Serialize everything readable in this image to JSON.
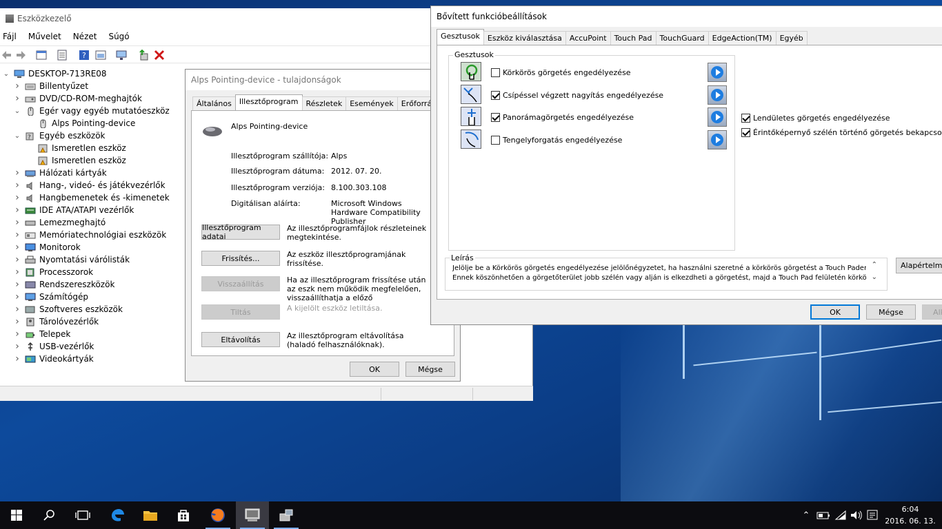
{
  "device_manager": {
    "title": "Eszközkezelő",
    "menu": [
      "Fájl",
      "Művelet",
      "Nézet",
      "Súgó"
    ],
    "root": "DESKTOP-713RE08",
    "tree": [
      {
        "label": "Billentyűzet",
        "depth": 1,
        "expanded": false,
        "icon": "keyboard-icon"
      },
      {
        "label": "DVD/CD-ROM-meghajtók",
        "depth": 1,
        "expanded": false,
        "icon": "disc-drive-icon"
      },
      {
        "label": "Egér vagy egyéb mutatóeszköz",
        "depth": 1,
        "expanded": true,
        "icon": "mouse-icon"
      },
      {
        "label": "Alps Pointing-device",
        "depth": 2,
        "expanded": null,
        "icon": "mouse-icon"
      },
      {
        "label": "Egyéb eszközök",
        "depth": 1,
        "expanded": true,
        "icon": "unknown-device-icon"
      },
      {
        "label": "Ismeretlen eszköz",
        "depth": 2,
        "expanded": null,
        "icon": "warning-device-icon"
      },
      {
        "label": "Ismeretlen eszköz",
        "depth": 2,
        "expanded": null,
        "icon": "warning-device-icon"
      },
      {
        "label": "Hálózati kártyák",
        "depth": 1,
        "expanded": false,
        "icon": "network-icon"
      },
      {
        "label": "Hang-, videó- és játékvezérlők",
        "depth": 1,
        "expanded": false,
        "icon": "speaker-icon"
      },
      {
        "label": "Hangbemenetek és -kimenetek",
        "depth": 1,
        "expanded": false,
        "icon": "speaker-icon"
      },
      {
        "label": "IDE ATA/ATAPI vezérlők",
        "depth": 1,
        "expanded": false,
        "icon": "ide-controller-icon"
      },
      {
        "label": "Lemezmeghajtó",
        "depth": 1,
        "expanded": false,
        "icon": "disk-icon"
      },
      {
        "label": "Memóriatechnológiai eszközök",
        "depth": 1,
        "expanded": false,
        "icon": "memory-icon"
      },
      {
        "label": "Monitorok",
        "depth": 1,
        "expanded": false,
        "icon": "monitor-icon"
      },
      {
        "label": "Nyomtatási várólisták",
        "depth": 1,
        "expanded": false,
        "icon": "printer-icon"
      },
      {
        "label": "Processzorok",
        "depth": 1,
        "expanded": false,
        "icon": "processor-icon"
      },
      {
        "label": "Rendszereszközök",
        "depth": 1,
        "expanded": false,
        "icon": "system-device-icon"
      },
      {
        "label": "Számítógép",
        "depth": 1,
        "expanded": false,
        "icon": "computer-icon"
      },
      {
        "label": "Szoftveres eszközök",
        "depth": 1,
        "expanded": false,
        "icon": "software-device-icon"
      },
      {
        "label": "Tárolóvezérlők",
        "depth": 1,
        "expanded": false,
        "icon": "storage-controller-icon"
      },
      {
        "label": "Telepek",
        "depth": 1,
        "expanded": false,
        "icon": "battery-icon"
      },
      {
        "label": "USB-vezérlők",
        "depth": 1,
        "expanded": false,
        "icon": "usb-icon"
      },
      {
        "label": "Videokártyák",
        "depth": 1,
        "expanded": false,
        "icon": "display-adapter-icon"
      }
    ]
  },
  "properties": {
    "title": "Alps Pointing-device - tulajdonságok",
    "tabs": [
      "Általános",
      "Illesztőprogram",
      "Részletek",
      "Események",
      "Erőforrások"
    ],
    "active_tab": 1,
    "device_name": "Alps Pointing-device",
    "fields": [
      {
        "label": "Illesztőprogram szállítója:",
        "value": "Alps"
      },
      {
        "label": "Illesztőprogram dátuma:",
        "value": "2012. 07. 20."
      },
      {
        "label": "Illesztőprogram verziója:",
        "value": "8.100.303.108"
      },
      {
        "label": "Digitálisan aláírta:",
        "value": "Microsoft Windows Hardware Compatibility Publisher"
      }
    ],
    "actions": [
      {
        "button": "Illesztőprogram adatai",
        "desc": "Az illesztőprogramfájlok részleteinek megtekintése.",
        "enabled": true
      },
      {
        "button": "Frissítés...",
        "desc": "Az eszköz illesztőprogramjának frissítése.",
        "enabled": true
      },
      {
        "button": "Visszaállítás",
        "desc": "Ha az illesztőprogram frissítése után az eszk nem működik megfelelően, visszaállíthatja a előző illesztőprogramot.",
        "enabled": false
      },
      {
        "button": "Tiltás",
        "desc": "A kijelölt eszköz letiltása.",
        "enabled": false
      },
      {
        "button": "Eltávolítás",
        "desc": "Az illesztőprogram eltávolítása (haladó felhasználóknak).",
        "enabled": true
      }
    ],
    "ok": "OK",
    "cancel": "Mégse"
  },
  "advanced": {
    "title": "Bővített funkcióbeállítások",
    "tabs": [
      "Gesztusok",
      "Eszköz kiválasztása",
      "AccuPoint",
      "Touch Pad",
      "TouchGuard",
      "EdgeAction(TM)",
      "Egyéb"
    ],
    "active_tab": 0,
    "group_label": "Gesztusok",
    "gestures": [
      {
        "label": "Körkörös görgetés engedélyezése",
        "checked": false,
        "icon": "circular-scroll-icon"
      },
      {
        "label": "Csípéssel végzett nagyítás engedélyezése",
        "checked": true,
        "icon": "pinch-zoom-icon"
      },
      {
        "label": "Panorámagörgetés engedélyezése",
        "checked": true,
        "icon": "pan-scroll-icon"
      },
      {
        "label": "Tengelyforgatás engedélyezése",
        "checked": false,
        "icon": "rotate-icon"
      }
    ],
    "side_options": [
      {
        "label": "Lendületes görgetés engedélyezése",
        "checked": true
      },
      {
        "label": "Érintőképernyő szélén történő görgetés bekapcsolása",
        "checked": true
      }
    ],
    "description_label": "Leírás",
    "description_lines": [
      "Jelölje be a Körkörös görgetés engedélyezése jelölőnégyzetet, ha használni szeretné a körkörös görgetést a Touch Paden.",
      "Ennek köszönhetően a görgetőterület jobb szélén vagy alján is elkezdheti a görgetést, majd a Touch Pad felületén körkörös"
    ],
    "defaults_button": "Alapértelmez",
    "ok": "OK",
    "cancel": "Mégse",
    "apply": "Alk"
  },
  "taskbar": {
    "time": "6:04",
    "date": "2016. 06. 13."
  }
}
